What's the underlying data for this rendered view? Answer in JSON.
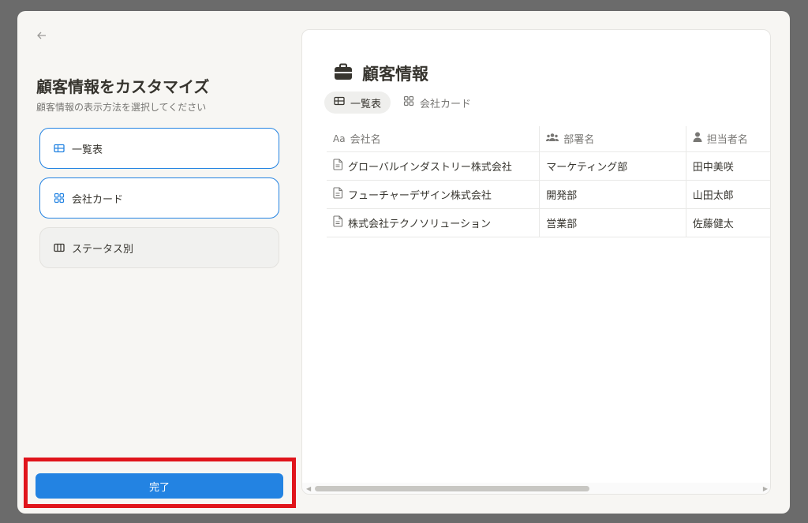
{
  "left": {
    "title": "顧客情報をカスタマイズ",
    "subtitle": "顧客情報の表示方法を選択してください",
    "options": [
      {
        "label": "一覧表",
        "icon": "table-icon",
        "selected": true
      },
      {
        "label": "会社カード",
        "icon": "gallery-icon",
        "selected": true
      },
      {
        "label": "ステータス別",
        "icon": "board-icon",
        "selected": false
      }
    ],
    "done_label": "完了"
  },
  "preview": {
    "title": "顧客情報",
    "title_icon": "briefcase-icon",
    "views": [
      {
        "label": "一覧表",
        "icon": "table-icon",
        "active": true
      },
      {
        "label": "会社カード",
        "icon": "gallery-icon",
        "active": false
      }
    ],
    "columns": [
      {
        "label": "会社名",
        "icon": "text-icon",
        "icon_text": "Aa"
      },
      {
        "label": "部署名",
        "icon": "people-icon"
      },
      {
        "label": "担当者名",
        "icon": "person-icon"
      }
    ],
    "rows": [
      {
        "company": "グローバルインダストリー株式会社",
        "department": "マーケティング部",
        "contact": "田中美咲"
      },
      {
        "company": "フューチャーデザイン株式会社",
        "department": "開発部",
        "contact": "山田太郎"
      },
      {
        "company": "株式会社テクノソリューション",
        "department": "営業部",
        "contact": "佐藤健太"
      }
    ]
  },
  "colors": {
    "accent": "#2383e2",
    "highlight_box": "#e0141b",
    "backdrop": "#6b6b6b",
    "panel": "#f7f6f3"
  }
}
